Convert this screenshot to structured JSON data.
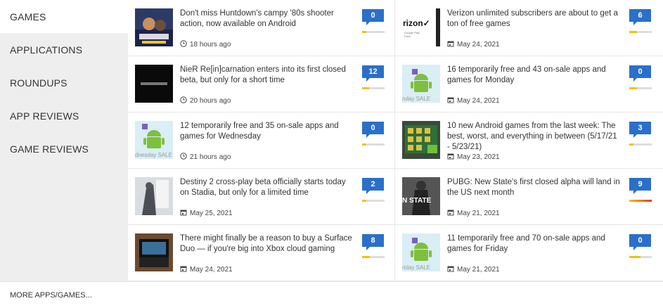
{
  "sidebar": {
    "items": [
      {
        "label": "GAMES",
        "active": true
      },
      {
        "label": "APPLICATIONS",
        "active": false
      },
      {
        "label": "ROUNDUPS",
        "active": false
      },
      {
        "label": "APP REVIEWS",
        "active": false
      },
      {
        "label": "GAME REVIEWS",
        "active": false
      }
    ]
  },
  "articles": [
    {
      "title": "Don't miss Huntdown's campy '80s shooter action, now available on Android",
      "meta": "18 hours ago",
      "meta_icon": "clock-icon",
      "comments": "0",
      "rating": 0.2,
      "thumb_text": ""
    },
    {
      "title": "Verizon unlimited subscribers are about to get a ton of free games",
      "meta": "May 24, 2021",
      "meta_icon": "calendar-icon",
      "comments": "6",
      "rating": 0.35,
      "thumb_text": "rizon✓"
    },
    {
      "title": "NieR Re[in]carnation enters into its first closed beta, but only for a short time",
      "meta": "20 hours ago",
      "meta_icon": "clock-icon",
      "comments": "12",
      "rating": 0.3,
      "thumb_text": ""
    },
    {
      "title": "16 temporarily free and 43 on-sale apps and games for Monday",
      "meta": "May 24, 2021",
      "meta_icon": "calendar-icon",
      "comments": "0",
      "rating": 0.35,
      "thumb_text": "nday SALE"
    },
    {
      "title": "12 temporarily free and 35 on-sale apps and games for Wednesday",
      "meta": "21 hours ago",
      "meta_icon": "clock-icon",
      "comments": "0",
      "rating": 0.2,
      "thumb_text": "dnesday SALE"
    },
    {
      "title": "10 new Android games from the last week: The best, worst, and everything in between (5/17/21 - 5/23/21)",
      "meta": "May 23, 2021",
      "meta_icon": "calendar-icon",
      "comments": "3",
      "rating": 0.2,
      "thumb_text": ""
    },
    {
      "title": "Destiny 2 cross-play beta officially starts today on Stadia, but only for a limited time",
      "meta": "May 25, 2021",
      "meta_icon": "calendar-icon",
      "comments": "2",
      "rating": 0.2,
      "thumb_text": ""
    },
    {
      "title": "PUBG: New State's first closed alpha will land in the US next month",
      "meta": "May 21, 2021",
      "meta_icon": "calendar-icon",
      "comments": "9",
      "rating": 1.0,
      "thumb_text": "N STATE"
    },
    {
      "title": "There might finally be a reason to buy a Surface Duo — if you're big into Xbox cloud gaming",
      "meta": "May 24, 2021",
      "meta_icon": "calendar-icon",
      "comments": "8",
      "rating": 0.35,
      "thumb_text": ""
    },
    {
      "title": "11 temporarily free and 70 on-sale apps and games for Friday",
      "meta": "May 21, 2021",
      "meta_icon": "calendar-icon",
      "comments": "0",
      "rating": 0.5,
      "thumb_text": "riday SALE"
    }
  ],
  "footer": {
    "label": "MORE APPS/GAMES..."
  },
  "colors": {
    "accent": "#2a6fc9",
    "bar_yellow": "#f2c200",
    "bar_hot": "#e8362a",
    "sidebar_bg": "#eeeeee"
  }
}
